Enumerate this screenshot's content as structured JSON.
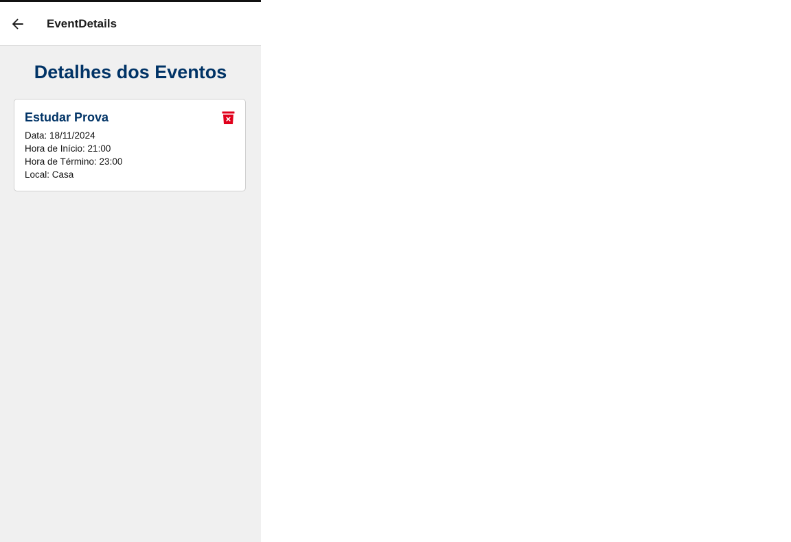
{
  "header": {
    "title": "EventDetails"
  },
  "page": {
    "title": "Detalhes dos Eventos"
  },
  "events": [
    {
      "name": "Estudar Prova",
      "date": "Data: 18/11/2024",
      "start": "Hora de Início: 21:00",
      "end": "Hora de Término: 23:00",
      "location": "Local: Casa"
    }
  ],
  "icons": {
    "back": "arrow-left-icon",
    "delete": "trash-icon"
  },
  "colors": {
    "title": "#003366",
    "delete": "#e0001b",
    "background": "#f0f0f0"
  }
}
